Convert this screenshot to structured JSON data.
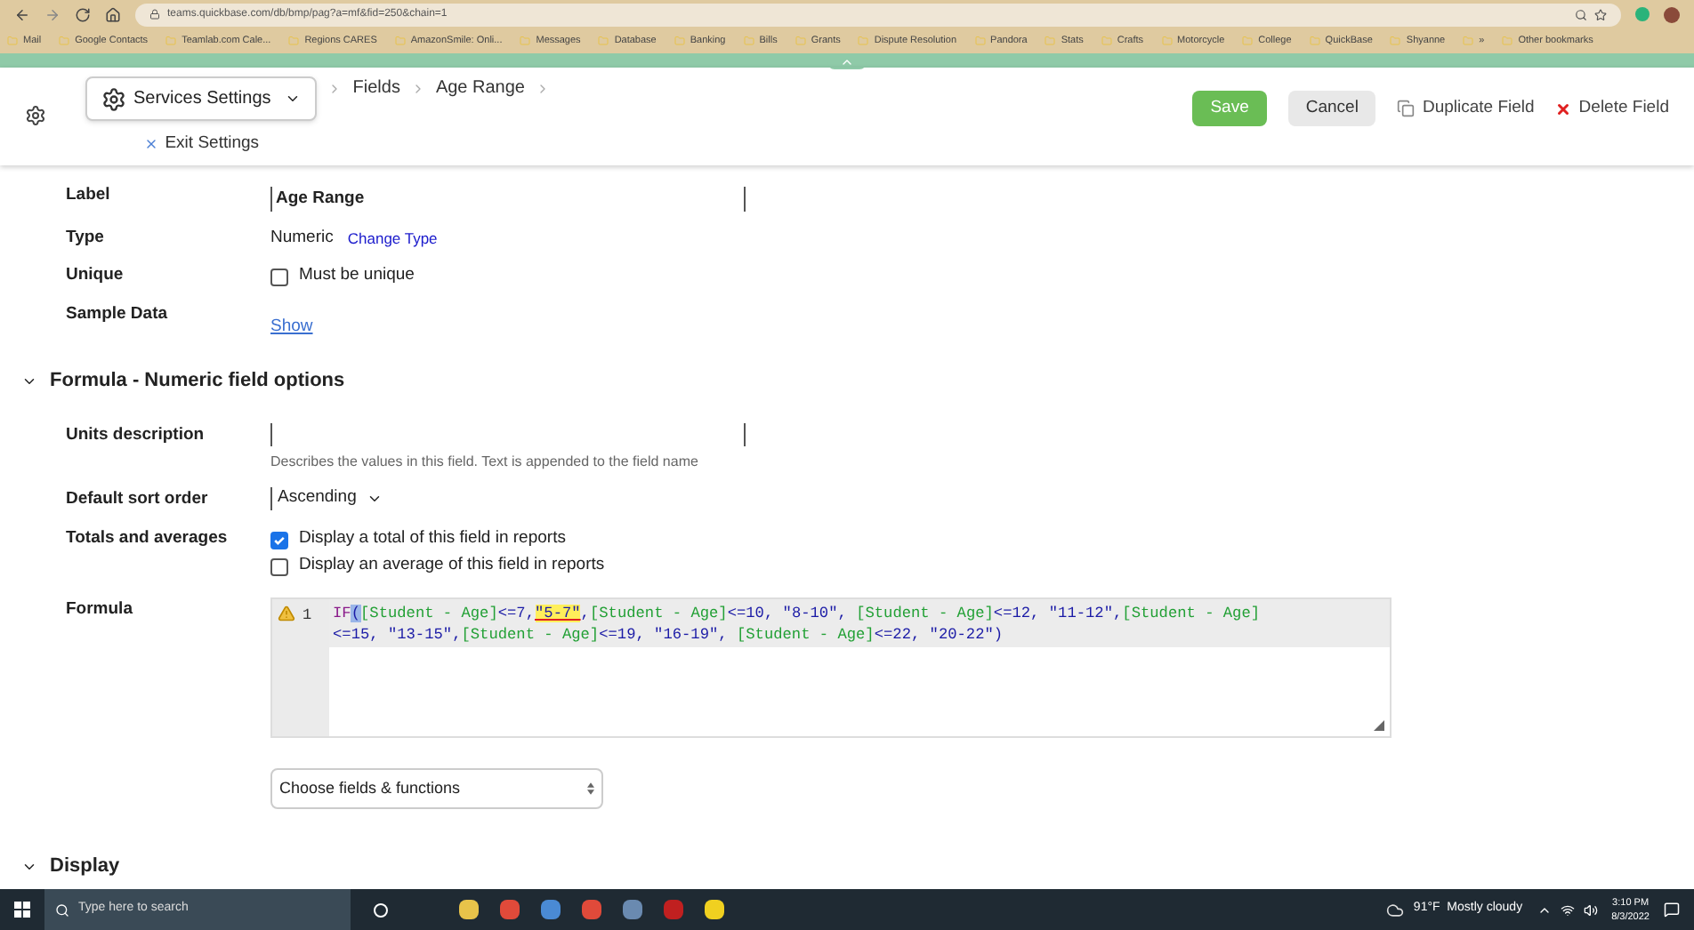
{
  "browser": {
    "url": "teams.quickbase.com/db/bmp/pag?a=mf&fid=250&chain=1",
    "bookmarks": [
      "Mail",
      "Google Contacts",
      "Teamlab.com Cale...",
      "Regions CARES",
      "AmazonSmile: Onli...",
      "Messages",
      "Database",
      "Banking",
      "Bills",
      "Grants",
      "Dispute Resolution",
      "Pandora",
      "Stats",
      "Crafts",
      "Motorcycle",
      "College",
      "QuickBase",
      "Shyanne",
      "»",
      "Other bookmarks"
    ]
  },
  "header": {
    "app_menu": "Services Settings",
    "breadcrumbs": [
      "Fields",
      "Age Range"
    ],
    "exit": "Exit Settings",
    "buttons": [
      {
        "kind": "primary",
        "label": "Save"
      },
      {
        "kind": "secondary",
        "label": "Cancel"
      },
      {
        "kind": "duplicate",
        "label": "Duplicate Field"
      },
      {
        "kind": "delete",
        "label": "Delete Field"
      }
    ]
  },
  "properties": {
    "label": {
      "name": "Label",
      "value": "Age Range"
    },
    "type": {
      "name": "Type",
      "value": "Numeric",
      "link": "Change Type"
    },
    "unique": {
      "name": "Unique",
      "option": "Must be unique",
      "checked": false
    },
    "sample": {
      "name": "Sample Data",
      "link": "Show"
    }
  },
  "formula_section": {
    "title": "Formula - Numeric field options",
    "expanded": true,
    "units": {
      "name": "Units description",
      "help": "Describes the values in this field. Text is appended to the field name"
    },
    "sort": {
      "name": "Default sort order",
      "value": "Ascending"
    },
    "totals": {
      "name": "Totals and averages",
      "options": [
        {
          "label": "Display a total of this field in reports",
          "checked": true
        },
        {
          "label": "Display an average of this field in reports",
          "checked": false
        }
      ]
    },
    "formula": {
      "name": "Formula",
      "line_number": "1",
      "lines": [
        [
          {
            "kind": "keyword",
            "text": "IF"
          },
          {
            "kind": "match",
            "text": "("
          },
          {
            "kind": "field",
            "text": "[Student - Age]"
          },
          {
            "kind": "plain",
            "text": "<=7,"
          },
          {
            "kind": "flagged",
            "text": "\"5-7\""
          },
          {
            "kind": "plain",
            "text": ","
          },
          {
            "kind": "field",
            "text": "[Student - Age]"
          },
          {
            "kind": "plain",
            "text": "<=10, "
          },
          {
            "kind": "string",
            "text": "\"8-10\""
          },
          {
            "kind": "plain",
            "text": ", "
          },
          {
            "kind": "field",
            "text": "[Student - Age]"
          },
          {
            "kind": "plain",
            "text": "<=12, "
          },
          {
            "kind": "string",
            "text": "\"11-12\""
          },
          {
            "kind": "plain",
            "text": ","
          },
          {
            "kind": "field",
            "text": "[Student - Age]"
          }
        ],
        [
          {
            "kind": "plain",
            "text": "<=15, "
          },
          {
            "kind": "string",
            "text": "\"13-15\""
          },
          {
            "kind": "plain",
            "text": ","
          },
          {
            "kind": "field",
            "text": "[Student - Age]"
          },
          {
            "kind": "plain",
            "text": "<=19, "
          },
          {
            "kind": "string",
            "text": "\"16-19\""
          },
          {
            "kind": "plain",
            "text": ", "
          },
          {
            "kind": "field",
            "text": "[Student - Age]"
          },
          {
            "kind": "plain",
            "text": "<=22, "
          },
          {
            "kind": "string",
            "text": "\"20-22\""
          },
          {
            "kind": "plain",
            "text": ")"
          }
        ]
      ]
    },
    "chooser": "Choose fields & functions"
  },
  "next_section": {
    "title": "Display",
    "expanded": true
  },
  "taskbar": {
    "search": "Type here to search",
    "weather": "91°F  Mostly cloudy",
    "time": "3:10 PM",
    "date": "8/3/2022"
  }
}
